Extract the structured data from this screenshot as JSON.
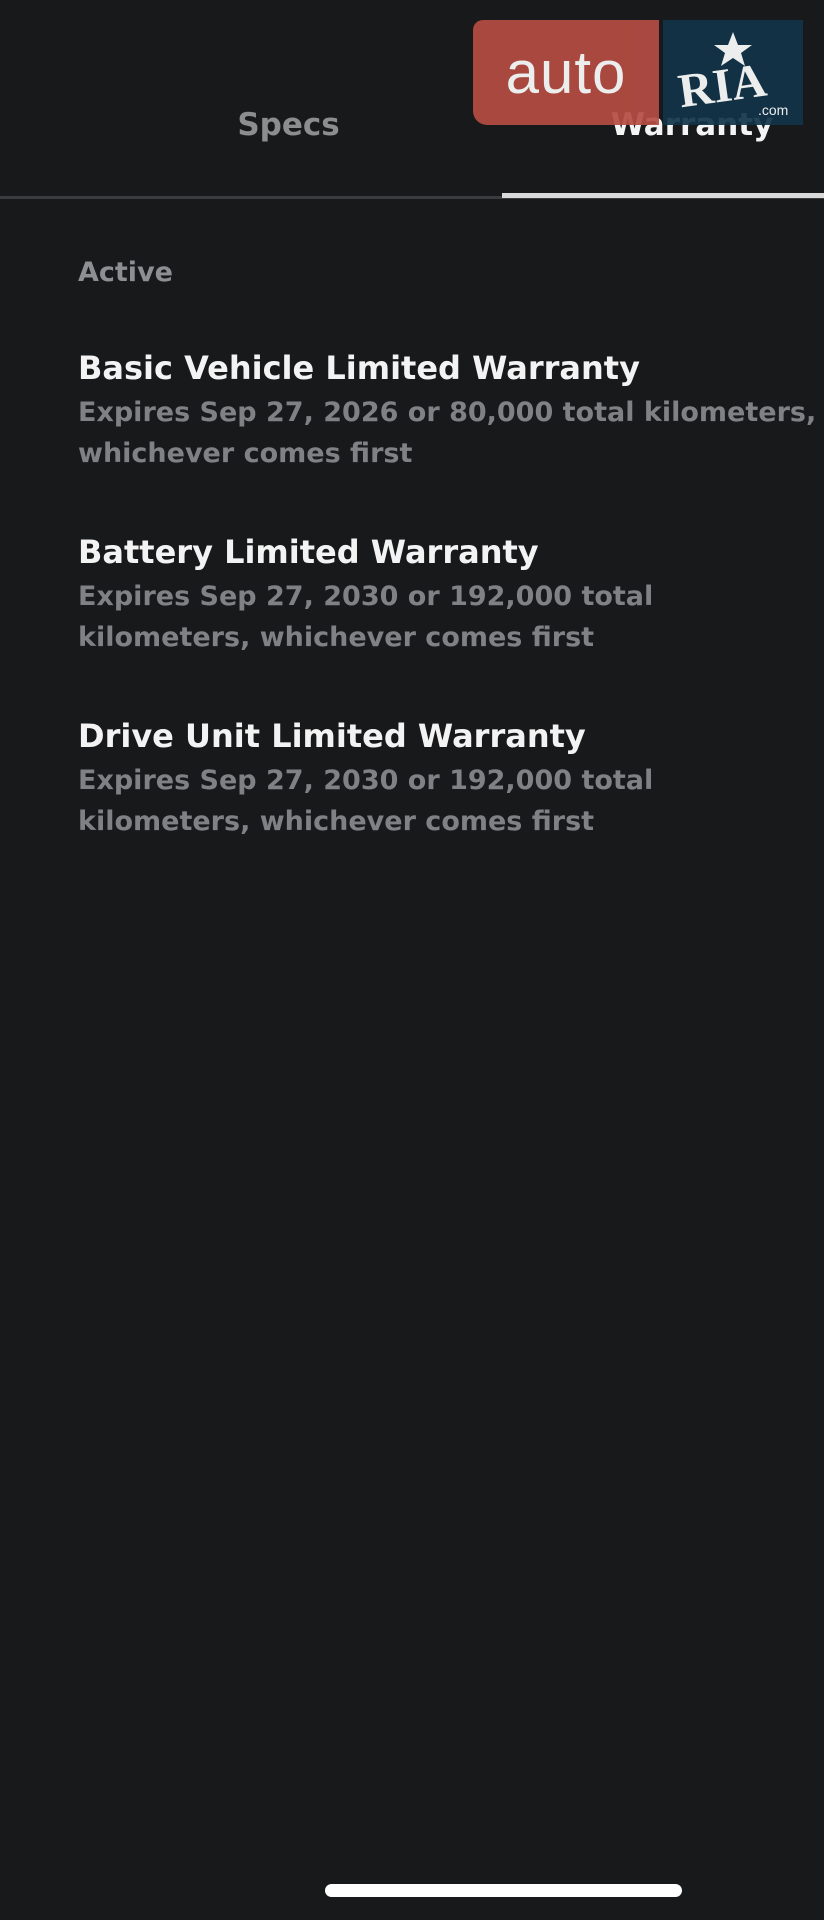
{
  "tabs": [
    {
      "label": "Specs",
      "active": false
    },
    {
      "label": "Warranty",
      "active": true
    }
  ],
  "watermark": {
    "left_text": "auto",
    "right_text": "RIA",
    "suffix": ".com",
    "left_color": "#b54c43",
    "right_color": "#123449"
  },
  "section": {
    "label": "Active"
  },
  "warranties": [
    {
      "title": "Basic Vehicle Limited Warranty",
      "description": "Expires Sep 27, 2026 or 80,000 total kilometers, whichever comes first"
    },
    {
      "title": "Battery Limited Warranty",
      "description": "Expires Sep 27, 2030 or 192,000 total kilometers, whichever comes first"
    },
    {
      "title": "Drive Unit Limited Warranty",
      "description": "Expires Sep 27, 2030 or 192,000 total kilometers, whichever comes first"
    }
  ],
  "colors": {
    "background": "#18191b",
    "title": "#f3f3f3",
    "secondary": "#808184",
    "active_indicator": "#d8d8d8"
  }
}
